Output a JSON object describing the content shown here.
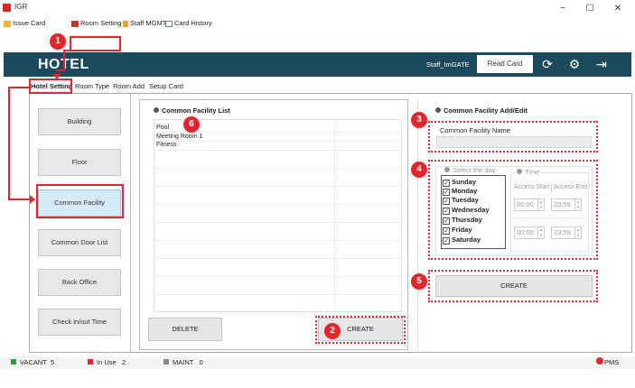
{
  "window": {
    "title": "IGR",
    "minimize": "−",
    "maximize": "☐",
    "close": "✕"
  },
  "menu": {
    "items": [
      {
        "label": "Issue Card"
      },
      {
        "label": "Room Setting"
      },
      {
        "label": "Staff MGMT"
      },
      {
        "label": "Card History"
      }
    ]
  },
  "header": {
    "logo": "HOTEL",
    "staff_id": "Staff_ImGATE",
    "read_card": "Read Card"
  },
  "tabs": [
    {
      "label": "Hotel Setting"
    },
    {
      "label": "Room Type"
    },
    {
      "label": "Room Add"
    },
    {
      "label": "Setup Card"
    }
  ],
  "sidebar": {
    "items": [
      {
        "label": "Building"
      },
      {
        "label": "Floor"
      },
      {
        "label": "Common Facility"
      },
      {
        "label": "Common Door List"
      },
      {
        "label": "Back Office"
      },
      {
        "label": "Check in/out Time"
      }
    ]
  },
  "list_panel": {
    "title": "Common Facility List",
    "items": [
      "Pool",
      "Meeting Room 1",
      "Fitness"
    ],
    "delete_label": "DELETE",
    "create_label": "CREATE"
  },
  "edit_panel": {
    "title": "Common Facility Add/Edit",
    "name_label": "Common Facility Name",
    "name_value": "",
    "select_day_label": "Select the day",
    "time_label": "Time",
    "days": [
      "Sunday",
      "Monday",
      "Tuesday",
      "Wednesday",
      "Thursday",
      "Friday",
      "Saturday"
    ],
    "access_start_label": "Access Start",
    "access_end_label": "Access End Ti",
    "time_rows": [
      {
        "start": "00:00",
        "end": "23:59"
      },
      {
        "start": "00:00",
        "end": "23:59"
      }
    ],
    "create_label": "CREATE"
  },
  "footer": {
    "vacant_label": "VACANT",
    "vacant_count": "5",
    "inuse_label": "In Use",
    "inuse_count": "2",
    "maint_label": "MAINT",
    "maint_count": "0",
    "pms_label": "PMS"
  },
  "badges": [
    "1",
    "2",
    "3",
    "4",
    "5",
    "6"
  ],
  "colors": {
    "header_bg": "#1a4a5c",
    "annotation_red": "#e3262d",
    "active_bg": "#d6ebf8",
    "vacant": "#2e9a3b",
    "inuse": "#e3262d",
    "maint": "#888888",
    "pms": "#e3262d"
  }
}
